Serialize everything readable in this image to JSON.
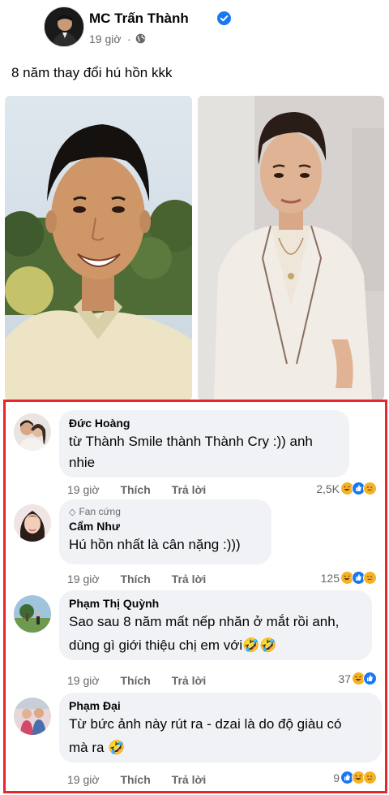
{
  "post": {
    "author": "MC Trấn Thành",
    "time": "19 giờ",
    "dot": "·",
    "text": "8 năm thay đổi hú hồn kkk"
  },
  "comments": [
    {
      "name": "Đức Hoàng",
      "badge": "",
      "text_line1": "từ Thành Smile thành Thành Cry :)) anh",
      "text_line2": "nhie",
      "time": "19 giờ",
      "like": "Thích",
      "reply": "Trả lời",
      "count": "2,5K",
      "reactions": [
        "haha-icon",
        "like-icon",
        "sad-icon"
      ]
    },
    {
      "name": "Cẩm Như",
      "badge": "Fan cứng",
      "text_line1": "Hú hồn nhất là cân nặng :)))",
      "text_line2": "",
      "time": "19 giờ",
      "like": "Thích",
      "reply": "Trả lời",
      "count": "125",
      "reactions": [
        "haha-icon",
        "like-icon",
        "sad-icon"
      ]
    },
    {
      "name": "Phạm Thị Quỳnh",
      "badge": "",
      "text_line1": "Sao sau 8 năm mất nếp nhăn ở mắt rồi anh,",
      "text_line2": "dùng gì giới thiệu chị em với🤣🤣",
      "time": "19 giờ",
      "like": "Thích",
      "reply": "Trả lời",
      "count": "37",
      "reactions": [
        "haha-icon",
        "like-icon"
      ]
    },
    {
      "name": "Phạm Đại",
      "badge": "",
      "text_line1": "Từ bức ảnh này rút ra - dzai là do độ giàu có",
      "text_line2": "mà ra 🤣",
      "time": "19 giờ",
      "like": "Thích",
      "reply": "Trả lời",
      "count": "9",
      "reactions": [
        "like-icon",
        "haha-icon",
        "sad-icon"
      ]
    }
  ],
  "colors": {
    "highlight_border": "#e8262b",
    "bubble": "#f0f2f5",
    "secondary_text": "#65676b",
    "like_blue": "#1877f2",
    "haha_yellow": "#f7b125"
  }
}
